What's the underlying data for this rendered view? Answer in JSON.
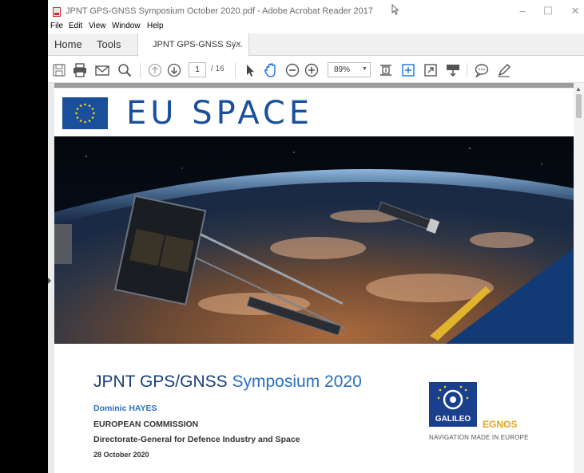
{
  "window": {
    "title": "JPNT GPS-GNSS Symposium October 2020.pdf - Adobe Acrobat Reader 2017",
    "controls": {
      "minimize": "–",
      "maximize": "☐",
      "close": "✕"
    }
  },
  "menu": [
    "File",
    "Edit",
    "View",
    "Window",
    "Help"
  ],
  "tabs": {
    "home": "Home",
    "tools": "Tools",
    "document": "JPNT GPS-GNSS Sy...",
    "close": "×"
  },
  "toolbar": {
    "page_current": "1",
    "page_total": "/ 16",
    "zoom": "89%",
    "icons": [
      "save-icon",
      "print-icon",
      "email-icon",
      "search-icon",
      "page-up-icon",
      "page-down-icon",
      "select-cursor-icon",
      "hand-tool-icon",
      "zoom-out-icon",
      "zoom-in-icon",
      "fit-page-icon",
      "scroll-mode-icon",
      "full-screen-icon",
      "read-mode-icon",
      "comment-icon",
      "highlight-pen-icon"
    ]
  },
  "document": {
    "header": "EU SPACE",
    "title_main": "JPNT GPS/GNSS",
    "title_year": "Symposium 2020",
    "author": "Dominic HAYES",
    "organization": "EUROPEAN COMMISSION",
    "directorate": "Directorate-General for Defence Industry and Space",
    "date": "28 October 2020",
    "logos": {
      "galileo": "GALILEO",
      "egnos": "EGNOS",
      "tagline": "NAVIGATION MADE IN EUROPE"
    }
  },
  "colors": {
    "eu_blue": "#1a4f9c",
    "title_blue": "#1a3f7a",
    "accent_blue": "#2a6fc0",
    "egnos_orange": "#e8a21b",
    "eu_star": "#ffd617"
  }
}
